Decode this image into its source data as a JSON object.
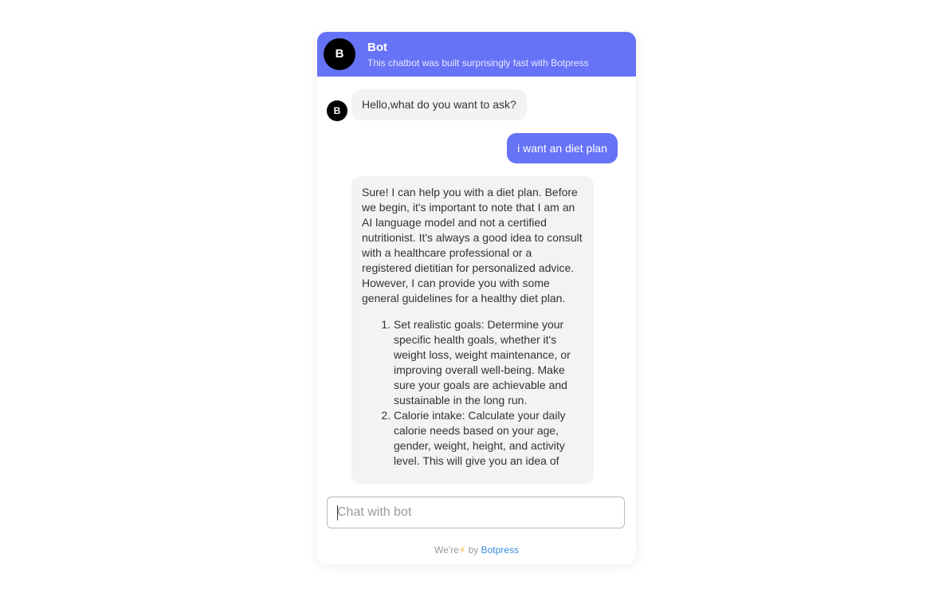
{
  "header": {
    "avatar_letter": "B",
    "title": "Bot",
    "subtitle": "This chatbot was built surprisingly fast with Botpress"
  },
  "messages": {
    "bot_avatar_letter": "B",
    "greeting": "Hello,what do you want to ask?",
    "user_message": "i want an diet plan",
    "bot_reply_intro": "Sure! I can help you with a diet plan. Before we begin, it's important to note that I am an AI language model and not a certified nutritionist. It's always a good idea to consult with a healthcare professional or a registered dietitian for personalized advice. However, I can provide you with some general guidelines for a healthy diet plan.",
    "bot_reply_items": [
      "Set realistic goals: Determine your specific health goals, whether it's weight loss, weight maintenance, or improving overall well-being. Make sure your goals are achievable and sustainable in the long run.",
      "Calorie intake: Calculate your daily calorie needs based on your age, gender, weight, height, and activity level. This will give you an idea of"
    ]
  },
  "composer": {
    "placeholder": "Chat with bot"
  },
  "footer": {
    "prefix": "We're",
    "bolt_icon": "⚡",
    "by": "by",
    "brand": "Botpress"
  },
  "colors": {
    "accent": "#6673f6",
    "bot_bubble": "#f3f3f3",
    "brand_link": "#3b8de0",
    "bolt": "#f2b01e"
  }
}
